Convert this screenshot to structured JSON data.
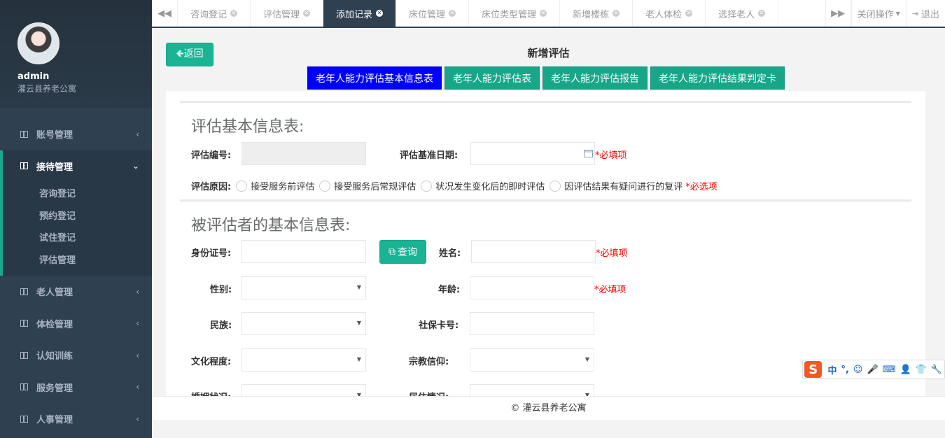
{
  "sidebar": {
    "username": "admin",
    "org": "灌云县养老公寓",
    "menu_top": [
      {
        "label": "账号管理",
        "arrow": "‹"
      }
    ],
    "open_group": {
      "label": "接待管理",
      "arrow": "⌄",
      "children": [
        "咨询登记",
        "预约登记",
        "试住登记",
        "评估管理"
      ]
    },
    "menu_bottom": [
      {
        "label": "老人管理",
        "arrow": "‹"
      },
      {
        "label": "体检管理",
        "arrow": "‹"
      },
      {
        "label": "认知训练",
        "arrow": "‹"
      },
      {
        "label": "服务管理",
        "arrow": "‹"
      },
      {
        "label": "人事管理",
        "arrow": "‹"
      }
    ]
  },
  "tabbar": {
    "prev": "◀◀",
    "next": "▶▶",
    "tabs": [
      {
        "label": "咨询登记",
        "active": false
      },
      {
        "label": "评估管理",
        "active": false
      },
      {
        "label": "添加记录",
        "active": true
      },
      {
        "label": "床位管理",
        "active": false
      },
      {
        "label": "床位类型管理",
        "active": false
      },
      {
        "label": "新增楼栋",
        "active": false
      },
      {
        "label": "老人体检",
        "active": false
      },
      {
        "label": "选择老人",
        "active": false
      }
    ],
    "close_ops": "关闭操作",
    "logout": "退出"
  },
  "page": {
    "back": "🡸返回",
    "title": "新增评估",
    "steps": [
      "老年人能力评估基本信息表",
      "老年人能力评估表",
      "老年人能力评估报告",
      "老年人能力评估结果判定卡"
    ],
    "active_step": 0
  },
  "section1": {
    "title": "评估基本信息表:",
    "code_label": "评估编号:",
    "date_label": "评估基准日期:",
    "required": "*必填项",
    "reason_label": "评估原因:",
    "reasons": [
      "接受服务前评估",
      "接受服务后常规评估",
      "状况发生变化后的即时评估",
      "因评估结果有疑问进行的复评"
    ],
    "reason_required": "*必选项"
  },
  "section2": {
    "title": "被评估者的基本信息表:",
    "id_label": "身份证号:",
    "query": "查询",
    "name_label": "姓名:",
    "gender_label": "性别:",
    "age_label": "年龄:",
    "ethnic_label": "民族:",
    "social_label": "社保卡号:",
    "edu_label": "文化程度:",
    "religion_label": "宗教信仰:",
    "marital_label": "婚姻状况:",
    "living_label": "居住情况:",
    "required": "*必填项"
  },
  "footer": "© 灌云县养老公寓",
  "ime": {
    "logo": "S",
    "items": [
      "中",
      "°,",
      "☺",
      "🎤",
      "⌨",
      "👤",
      "👕",
      "🔧"
    ]
  },
  "colors": {
    "sidebar": "#2f4050",
    "accent": "#1ab394",
    "active_step": "#0000ff",
    "required": "#ff0000"
  }
}
